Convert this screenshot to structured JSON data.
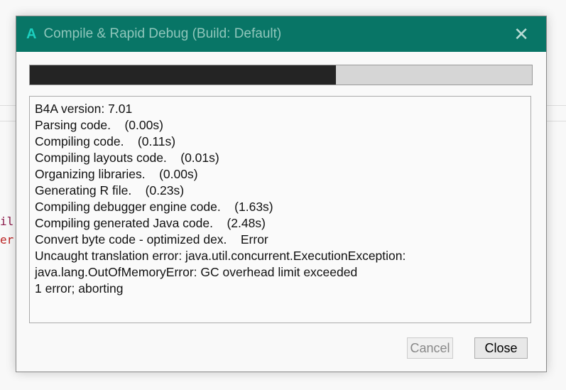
{
  "background": {
    "code_fragments": [
      "il",
      "er"
    ]
  },
  "dialog": {
    "title": "Compile & Rapid Debug (Build: Default)",
    "logo": "A",
    "progress_percent": 61,
    "log": [
      "B4A version: 7.01",
      "Parsing code.    (0.00s)",
      "Compiling code.    (0.11s)",
      "Compiling layouts code.    (0.01s)",
      "Organizing libraries.    (0.00s)",
      "Generating R file.    (0.23s)",
      "Compiling debugger engine code.    (1.63s)",
      "Compiling generated Java code.    (2.48s)",
      "Convert byte code - optimized dex.    Error",
      "Uncaught translation error: java.util.concurrent.ExecutionException:",
      "java.lang.OutOfMemoryError: GC overhead limit exceeded",
      "1 error; aborting"
    ],
    "cancel_label": "Cancel",
    "close_label": "Close"
  }
}
